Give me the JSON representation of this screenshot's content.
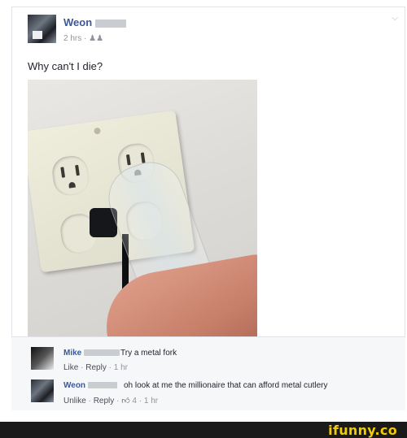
{
  "post": {
    "author": "Weon",
    "time": "2 hrs",
    "separator": "·",
    "audience_icon": "friends-icon",
    "text": "Why can't I die?",
    "menu_icon": "chevron-down-icon"
  },
  "comments": [
    {
      "author": "Mike",
      "text": "Try a metal fork",
      "actions": {
        "like": "Like",
        "reply": "Reply",
        "time": "1 hr"
      }
    },
    {
      "author": "Weon",
      "text": "oh look at me the millionaire that can afford metal cutlery",
      "actions": {
        "unlike": "Unlike",
        "reply": "Reply",
        "like_icon": "thumbs-up-icon",
        "like_count": "4",
        "time": "1 hr"
      }
    }
  ],
  "watermark": {
    "text": "ifunny.co"
  },
  "colors": {
    "link": "#3b5998",
    "meta": "#90949c",
    "watermark": "#f2cb05",
    "footer_bg": "#1a1a1a"
  }
}
